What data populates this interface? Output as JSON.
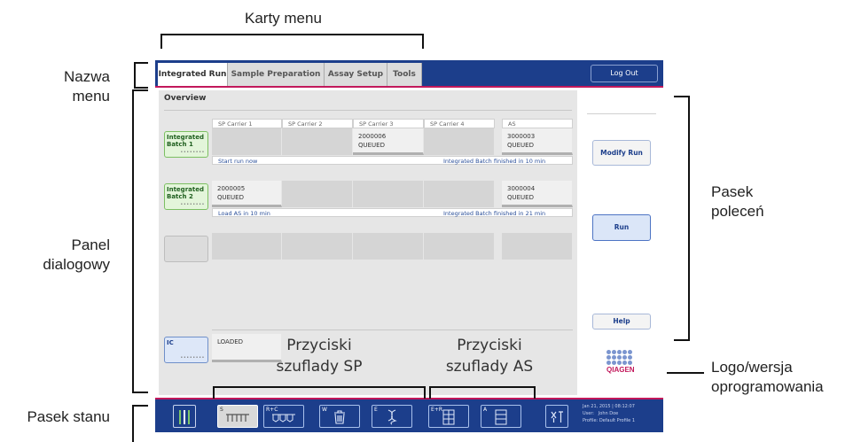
{
  "callouts": {
    "top": "Karty menu",
    "menu_name_line1": "Nazwa",
    "menu_name_line2": "menu",
    "dialog_line1": "Panel",
    "dialog_line2": "dialogowy",
    "status": "Pasek stanu",
    "command_line1": "Pasek",
    "command_line2": "poleceń",
    "logo_line1": "Logo/wersja",
    "logo_line2": "oprogramowania",
    "sp_buttons_line1": "Przyciski",
    "sp_buttons_line2": "szuflady SP",
    "as_buttons_line1": "Przyciski",
    "as_buttons_line2": "szuflady AS"
  },
  "tabs": [
    "Integrated Run",
    "Sample Preparation",
    "Assay Setup",
    "Tools"
  ],
  "logout_label": "Log Out",
  "overview_title": "Overview",
  "columns": [
    "SP Carrier 1",
    "SP Carrier 2",
    "SP Carrier 3",
    "SP Carrier 4",
    "AS"
  ],
  "batches": [
    {
      "name_line1": "Integrated",
      "name_line2": "Batch 1",
      "dots": "••••••••",
      "cells": [
        "",
        "",
        "2000006\nQUEUED",
        "",
        "3000003\nQUEUED"
      ],
      "info_left": "Start run now",
      "info_right": "Integrated Batch finished in 10 min"
    },
    {
      "name_line1": "Integrated",
      "name_line2": "Batch 2",
      "dots": "••••••••",
      "cells": [
        "2000005\nQUEUED",
        "",
        "",
        "",
        "3000004\nQUEUED"
      ],
      "info_left": "Load AS in 10 min",
      "info_right": "Integrated Batch finished in 21 min"
    }
  ],
  "ic": {
    "label": "IC",
    "dots": "••••••••",
    "status": "LOADED"
  },
  "sidebar": {
    "modify_run": "Modify Run",
    "run": "Run",
    "help": "Help",
    "logo_text": "QIAGEN"
  },
  "statusbar": {
    "drawers": [
      {
        "label": "S",
        "icon": "sample-rack-icon"
      },
      {
        "label": "R+C",
        "icon": "reagent-cartridge-icon"
      },
      {
        "label": "W",
        "icon": "waste-bin-icon"
      },
      {
        "label": "E",
        "icon": "eluate-icon"
      },
      {
        "label": "E+R",
        "icon": "eluate-reagent-icon"
      },
      {
        "label": "A",
        "icon": "assay-icon"
      }
    ],
    "info_line1": "Jan 21, 2015 | 08:12:07",
    "info_user_label": "User:",
    "info_user": "John Doe",
    "info_profile_label": "Profile:",
    "info_profile": "Default Profile 1"
  },
  "colors": {
    "brand_blue": "#1c3e8b",
    "accent_magenta": "#c2185b",
    "batch_green": "#e3f5da"
  }
}
